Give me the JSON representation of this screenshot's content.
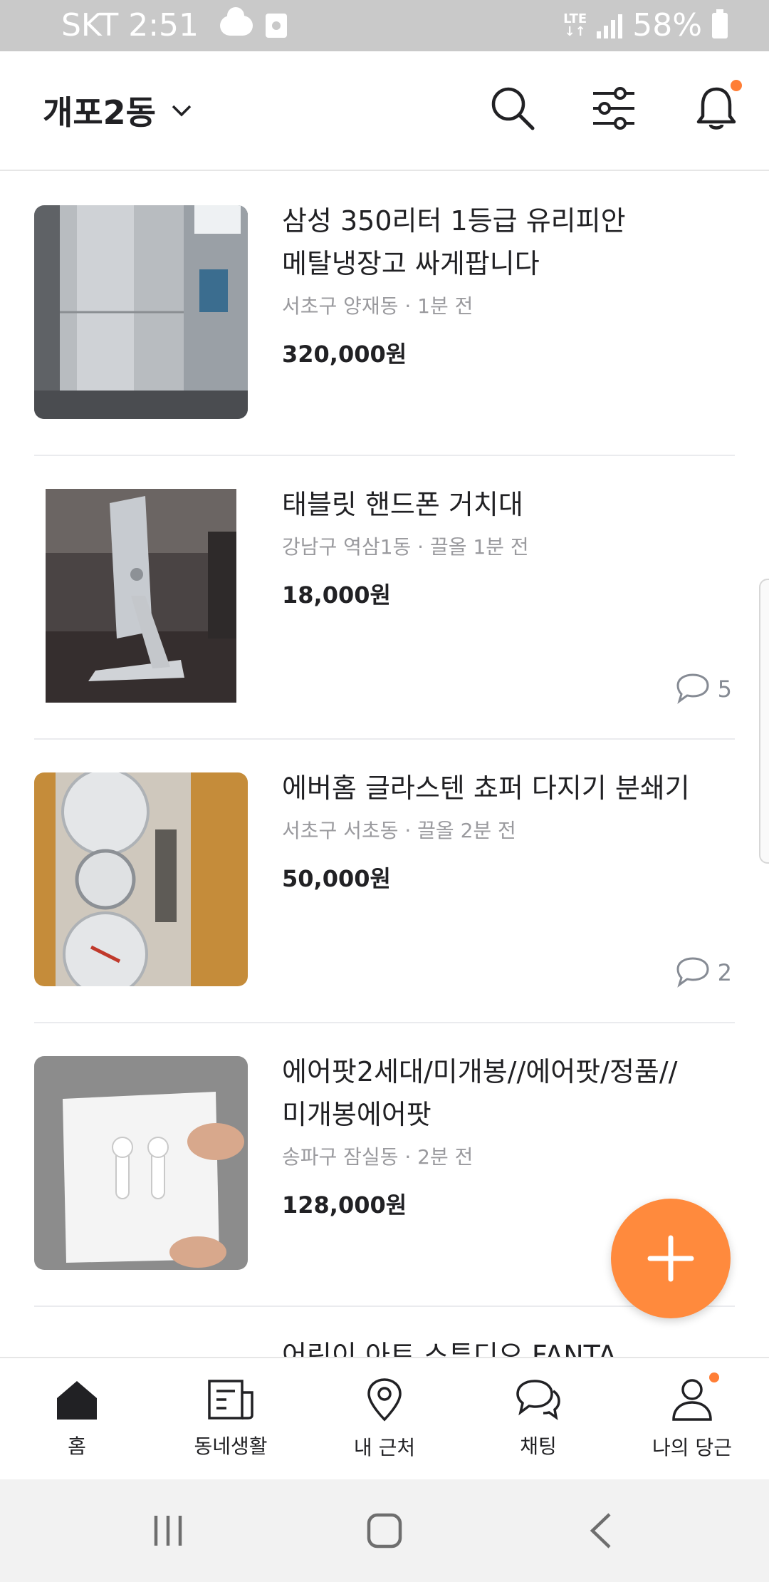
{
  "status_bar": {
    "carrier_time": "SKT 2:51",
    "network": "LTE",
    "battery": "58%"
  },
  "header": {
    "location": "개포2동",
    "icons": [
      "search-icon",
      "filter-icon",
      "bell-icon"
    ],
    "notification_dot": true
  },
  "items": [
    {
      "title": "삼성 350리터 1등급 유리피안\n메탈냉장고 싸게팝니다",
      "meta": "서초구 양재동 · 1분 전",
      "price": "320,000원",
      "comments": null
    },
    {
      "title": "태블릿 핸드폰 거치대",
      "meta": "강남구 역삼1동 · 끌올 1분 전",
      "price": "18,000원",
      "comments": "5"
    },
    {
      "title": "에버홈 글라스텐 쵸퍼 다지기 분쇄기",
      "meta": "서초구 서초동 · 끌올 2분 전",
      "price": "50,000원",
      "comments": "2"
    },
    {
      "title": "에어팟2세대/미개봉//에어팟/정품//\n미개봉에어팟",
      "meta": "송파구 잠실동 · 2분 전",
      "price": "128,000원",
      "comments": null
    },
    {
      "title": "어린이 아트 스튜디오 FANTA",
      "meta": "",
      "price": "",
      "comments": null
    }
  ],
  "bottom_nav": [
    {
      "label": "홈",
      "icon": "home-icon",
      "active": true
    },
    {
      "label": "동네생활",
      "icon": "newspaper-icon",
      "active": false
    },
    {
      "label": "내 근처",
      "icon": "location-pin-icon",
      "active": false
    },
    {
      "label": "채팅",
      "icon": "chat-icon",
      "active": false
    },
    {
      "label": "나의 당근",
      "icon": "person-icon",
      "active": false,
      "dot": true
    }
  ],
  "colors": {
    "accent": "#ff8a3d",
    "text": "#212124",
    "meta": "#9a9a9e"
  }
}
